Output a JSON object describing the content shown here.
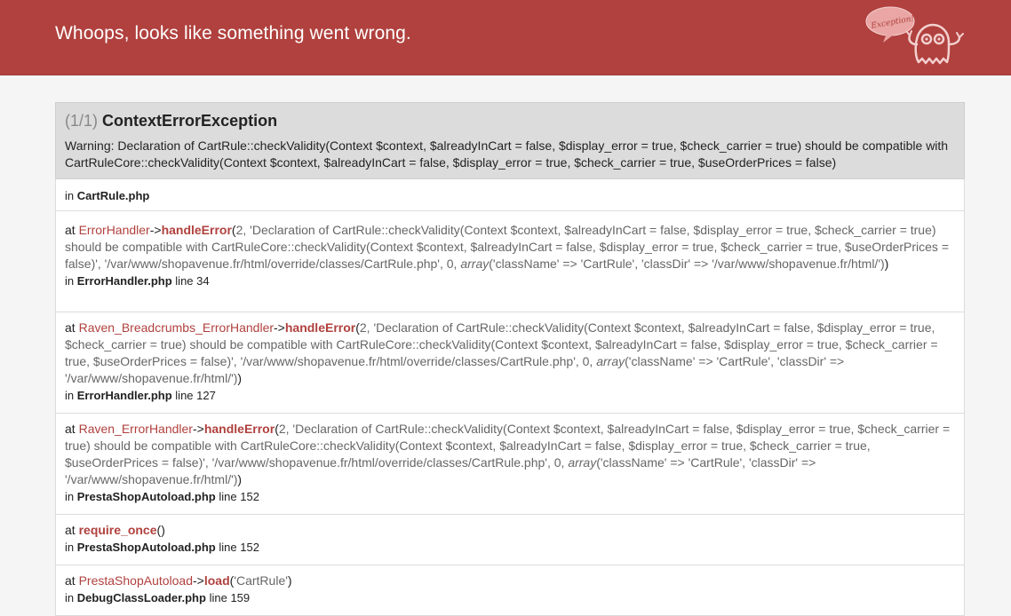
{
  "header": {
    "title": "Whoops, looks like something went wrong.",
    "mascot_text": "Exception!"
  },
  "exception": {
    "counter": "(1/1)",
    "class_name": "ContextErrorException",
    "message": "Warning: Declaration of CartRule::checkValidity(Context $context, $alreadyInCart = false, $display_error = true, $check_carrier = true) should be compatible with CartRuleCore::checkValidity(Context $context, $alreadyInCart = false, $display_error = true, $check_carrier = true, $useOrderPrices = false)"
  },
  "trace": [
    {
      "in_label": "in",
      "file": "CartRule.php",
      "line_label": "",
      "line": ""
    },
    {
      "at_label": "at",
      "class": "ErrorHandler",
      "arrow": "->",
      "function": "handleError",
      "open_paren": "(",
      "args_pre": "2, 'Declaration of CartRule::checkValidity(Context $context, $alreadyInCart = false, $display_error = true, $check_carrier = true) should be compatible with CartRuleCore::checkValidity(Context $context, $alreadyInCart = false, $display_error = true, $check_carrier = true, $useOrderPrices = false)', '/var/www/shopavenue.fr/html/override/classes/CartRule.php', 0, ",
      "args_kw": "array",
      "args_post": "('className' => 'CartRule', 'classDir' => '/var/www/shopavenue.fr/html/')",
      "close_paren": ")",
      "in_label": "in",
      "file": "ErrorHandler.php",
      "line_label": "line",
      "line": "34"
    },
    {
      "at_label": "at",
      "class": "Raven_Breadcrumbs_ErrorHandler",
      "arrow": "->",
      "function": "handleError",
      "open_paren": "(",
      "args_pre": "2, 'Declaration of CartRule::checkValidity(Context $context, $alreadyInCart = false, $display_error = true, $check_carrier = true) should be compatible with CartRuleCore::checkValidity(Context $context, $alreadyInCart = false, $display_error = true, $check_carrier = true, $useOrderPrices = false)', '/var/www/shopavenue.fr/html/override/classes/CartRule.php', 0, ",
      "args_kw": "array",
      "args_post": "('className' => 'CartRule', 'classDir' => '/var/www/shopavenue.fr/html/')",
      "close_paren": ")",
      "in_label": "in",
      "file": "ErrorHandler.php",
      "line_label": "line",
      "line": "127"
    },
    {
      "at_label": "at",
      "class": "Raven_ErrorHandler",
      "arrow": "->",
      "function": "handleError",
      "open_paren": "(",
      "args_pre": "2, 'Declaration of CartRule::checkValidity(Context $context, $alreadyInCart = false, $display_error = true, $check_carrier = true) should be compatible with CartRuleCore::checkValidity(Context $context, $alreadyInCart = false, $display_error = true, $check_carrier = true, $useOrderPrices = false)', '/var/www/shopavenue.fr/html/override/classes/CartRule.php', 0, ",
      "args_kw": "array",
      "args_post": "('className' => 'CartRule', 'classDir' => '/var/www/shopavenue.fr/html/')",
      "close_paren": ")",
      "in_label": "in",
      "file": "PrestaShopAutoload.php",
      "line_label": "line",
      "line": "152"
    },
    {
      "at_label": "at",
      "class": "",
      "arrow": "",
      "function": "require_once",
      "open_paren": "(",
      "args_pre": "",
      "args_kw": "",
      "args_post": "",
      "close_paren": ")",
      "in_label": "in",
      "file": "PrestaShopAutoload.php",
      "line_label": "line",
      "line": "152"
    },
    {
      "at_label": "at",
      "class": "PrestaShopAutoload",
      "arrow": "->",
      "function": "load",
      "open_paren": "(",
      "args_pre": "'CartRule'",
      "args_kw": "",
      "args_post": "",
      "close_paren": ")",
      "in_label": "in",
      "file": "DebugClassLoader.php",
      "line_label": "line",
      "line": "159"
    }
  ],
  "colors": {
    "header_bg": "#b0413e",
    "accent": "#b0413e",
    "exception_bg": "#dcdcdc",
    "page_bg": "#f5f5f5"
  }
}
